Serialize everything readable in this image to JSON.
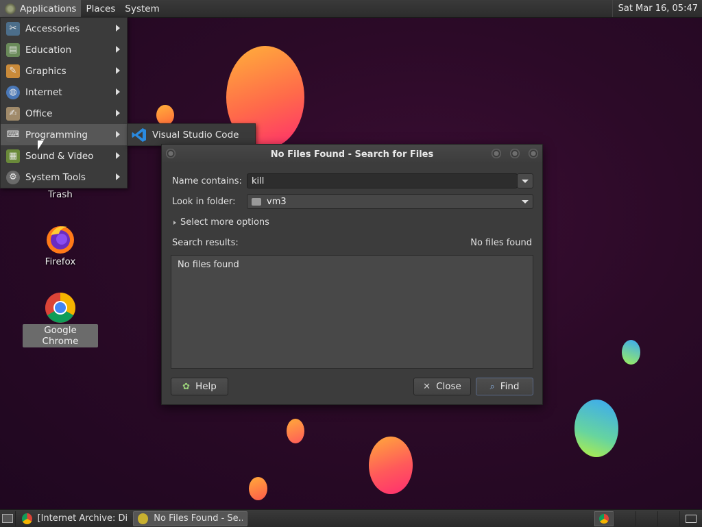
{
  "top_panel": {
    "menus": [
      "Applications",
      "Places",
      "System"
    ],
    "clock": "Sat Mar 16, 05:47"
  },
  "app_menu": {
    "items": [
      {
        "label": "Accessories"
      },
      {
        "label": "Education"
      },
      {
        "label": "Graphics"
      },
      {
        "label": "Internet"
      },
      {
        "label": "Office"
      },
      {
        "label": "Programming"
      },
      {
        "label": "Sound & Video"
      },
      {
        "label": "System Tools"
      }
    ],
    "submenu": {
      "label": "Visual Studio Code"
    }
  },
  "desktop_icons": [
    {
      "label": "Trash"
    },
    {
      "label": "Firefox"
    },
    {
      "label": "Google Chrome"
    }
  ],
  "dialog": {
    "title": "No Files Found - Search for Files",
    "name_label": "Name contains:",
    "name_value": "kill",
    "folder_label": "Look in folder:",
    "folder_value": "vm3",
    "more_options": "Select more options",
    "results_label": "Search results:",
    "results_status": "No files found",
    "results_body": "No files found",
    "help_button": "Help",
    "close_button": "Close",
    "find_button": "Find"
  },
  "taskbar": {
    "tasks": [
      {
        "label": "[Internet Archive: Di..."
      },
      {
        "label": "No Files Found - Se..."
      }
    ]
  },
  "colors": {
    "panel": "#2c2c2c",
    "menu_bg": "#3b3b3b",
    "menu_hover": "#575757",
    "dialog_bg": "#3c3c3c",
    "desktop_bg": "#2b0a27",
    "vscode_blue": "#2a8ae0"
  }
}
